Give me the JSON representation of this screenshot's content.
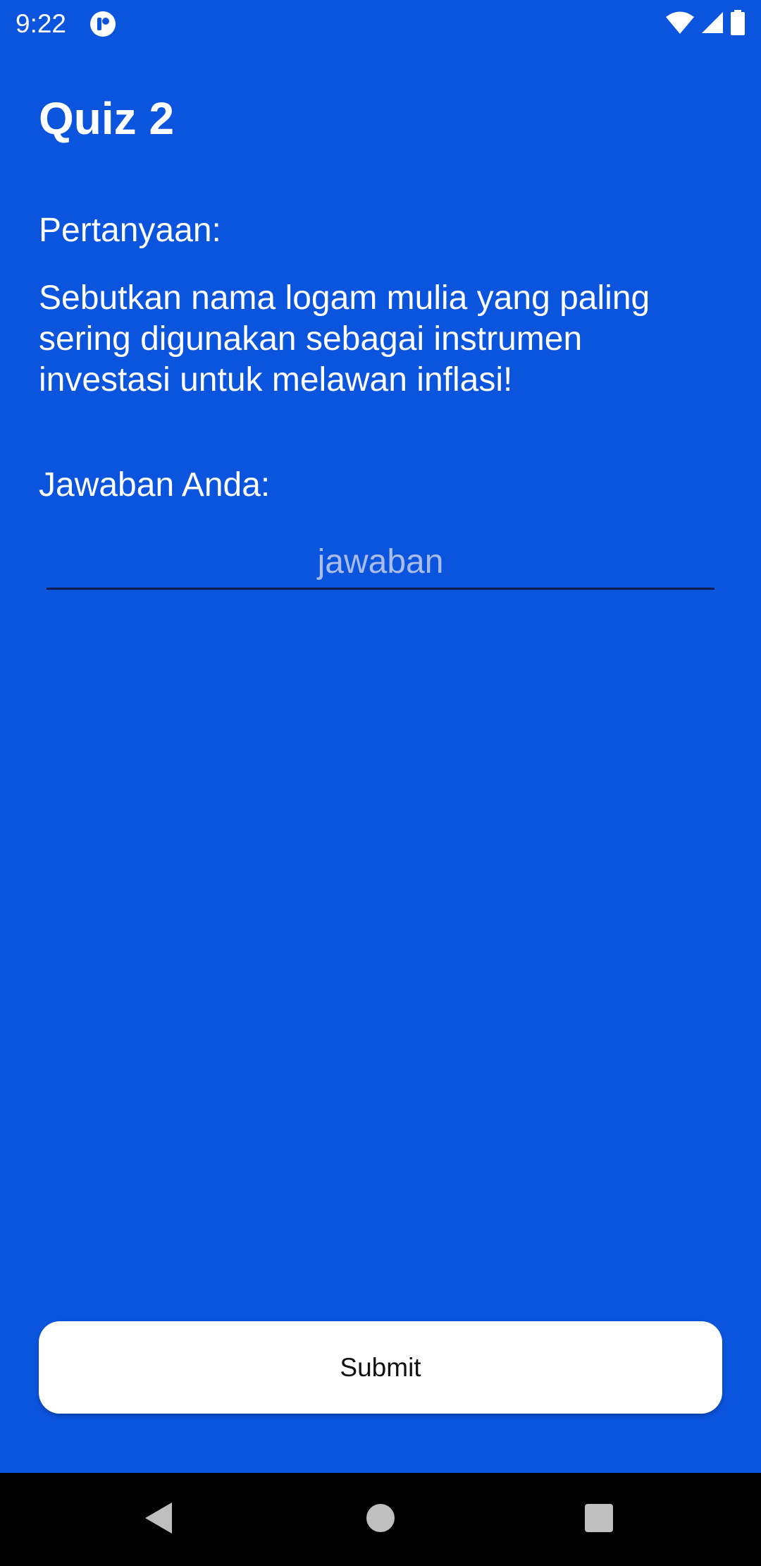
{
  "status_bar": {
    "time": "9:22",
    "icons": [
      "app-notification-icon",
      "wifi-icon",
      "signal-icon",
      "battery-icon"
    ]
  },
  "quiz": {
    "title": "Quiz 2",
    "question_label": "Pertanyaan:",
    "question_text": "Sebutkan nama logam mulia yang paling sering digunakan sebagai instrumen investasi untuk melawan inflasi!",
    "answer_label": "Jawaban Anda:",
    "answer_placeholder": "jawaban",
    "answer_value": "",
    "submit_label": "Submit"
  },
  "nav_bar": {
    "icons": [
      "back-icon",
      "home-icon",
      "recents-icon"
    ]
  },
  "colors": {
    "background": "#0a54de",
    "text": "#ffffff",
    "button_bg": "#ffffff",
    "button_text": "#111111",
    "nav_bg": "#000000"
  }
}
